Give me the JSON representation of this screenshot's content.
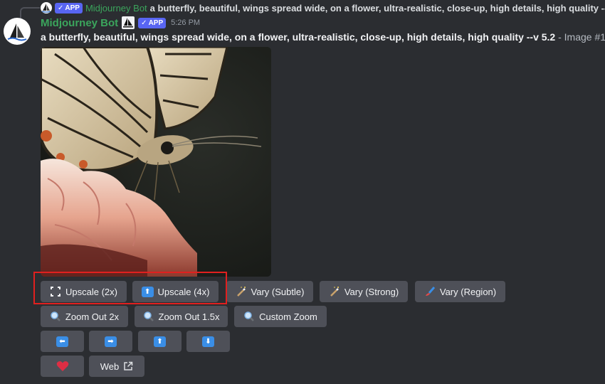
{
  "reply": {
    "badge": "APP",
    "author": "Midjourney Bot",
    "text": "a butterfly, beautiful, wings spread wide, on a flower, ultra-realistic, close-up, high details, high quality --v 5.2 -"
  },
  "message": {
    "author": "Midjourney Bot",
    "badge": "APP",
    "timestamp": "5:26 PM",
    "prompt": "a butterfly, beautiful, wings spread wide, on a flower, ultra-realistic, close-up, high details, high quality --v 5.2",
    "suffix": "- Image #1"
  },
  "buttons": {
    "row1": [
      "Upscale (2x)",
      "Upscale (4x)",
      "Vary (Subtle)",
      "Vary (Strong)",
      "Vary (Region)"
    ],
    "row2": [
      "Zoom Out 2x",
      "Zoom Out 1.5x",
      "Custom Zoom"
    ],
    "row4_web": "Web"
  },
  "icons": {
    "upscale_2x": "expand-corners-icon",
    "upscale_4x": "upload-arrow-icon",
    "vary": "magic-wand-icon",
    "vary_region": "brush-icon",
    "zoom": "magnifier-icon",
    "pan": [
      "arrow-left-icon",
      "arrow-right-icon",
      "arrow-up-icon",
      "arrow-down-icon"
    ],
    "favorite": "heart-icon",
    "external": "external-link-icon"
  },
  "colors": {
    "background": "#2b2d31",
    "button": "#4e5058",
    "author": "#3ba55c",
    "badge": "#5865f2",
    "highlight": "#e0201f",
    "arrow_icon": "#3a8ee6"
  }
}
